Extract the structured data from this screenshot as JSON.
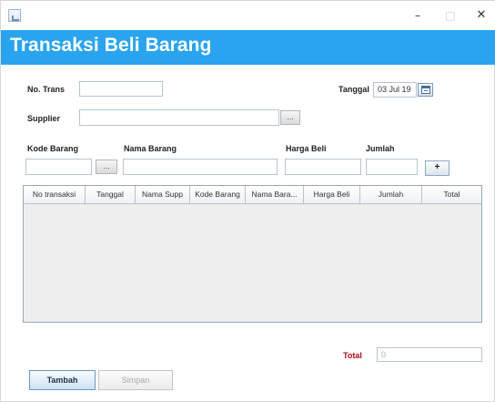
{
  "window": {
    "title": "",
    "controls": {
      "minimize": "–",
      "maximize": "□",
      "close": "✕"
    }
  },
  "header": {
    "title": "Transaksi Beli Barang"
  },
  "form": {
    "no_trans_label": "No. Trans",
    "no_trans_value": "",
    "tanggal_label": "Tanggal",
    "tanggal_value": "03 Jul 19",
    "supplier_label": "Supplier",
    "supplier_value": "",
    "browse_label": "...",
    "kode_barang_label": "Kode Barang",
    "kode_barang_value": "",
    "nama_barang_label": "Nama Barang",
    "nama_barang_value": "",
    "harga_beli_label": "Harga Beli",
    "harga_beli_value": "",
    "jumlah_label": "Jumlah",
    "jumlah_value": "",
    "add_item_label": "+"
  },
  "table": {
    "columns": [
      "No transaksi",
      "Tanggal",
      "Nama Supp",
      "Kode Barang",
      "Nama Bara...",
      "Harga Beli",
      "Jumlah",
      "Total"
    ],
    "rows": []
  },
  "summary": {
    "total_label": "Total",
    "total_value": "0"
  },
  "actions": {
    "tambah_label": "Tambah",
    "simpan_label": "Simpan"
  },
  "colors": {
    "header_bg": "#2aa4ef",
    "total_label": "#a40f16"
  },
  "icons": {
    "app": "app-window-icon",
    "calendar": "calendar-icon"
  }
}
